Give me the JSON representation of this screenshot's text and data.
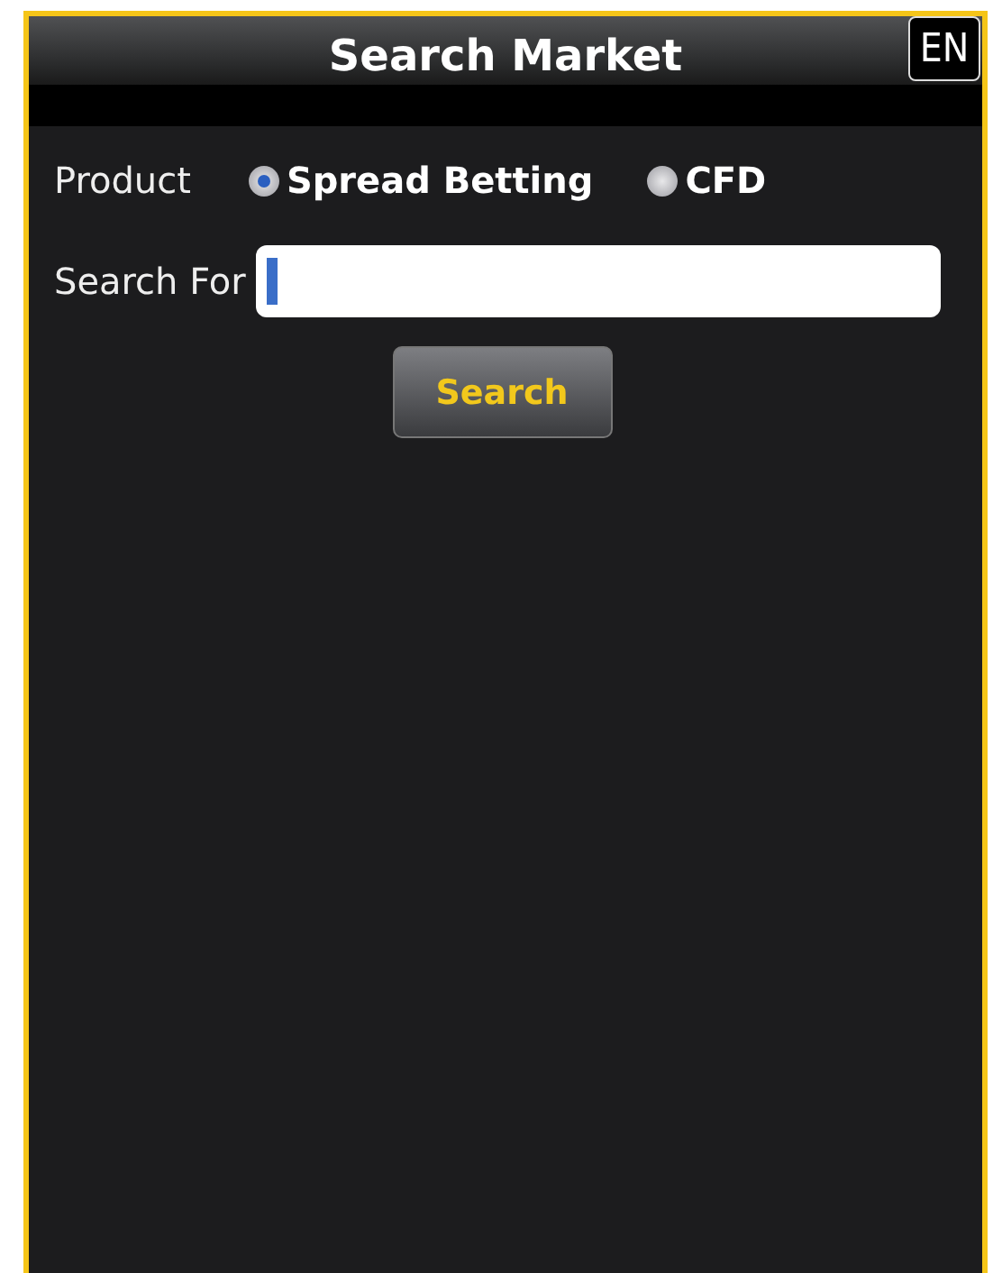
{
  "window": {
    "title": "Search Market",
    "language_button": "EN"
  },
  "product": {
    "label": "Product",
    "options": [
      {
        "label": "Spread Betting",
        "selected": true
      },
      {
        "label": "CFD",
        "selected": false
      }
    ]
  },
  "search_for": {
    "label": "Search For",
    "focused": true
  },
  "search_button": "Search"
}
